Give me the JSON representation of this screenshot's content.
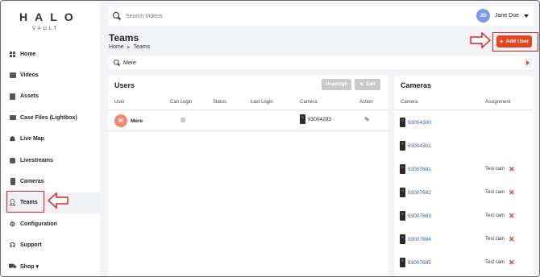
{
  "brand": {
    "name": "HALO",
    "sub": "VAULT"
  },
  "sidebar": {
    "items": [
      {
        "label": "Home",
        "icon": "grid-icon"
      },
      {
        "label": "Videos",
        "icon": "video-icon"
      },
      {
        "label": "Assets",
        "icon": "asset-icon"
      },
      {
        "label": "Case Files (Lightbox)",
        "icon": "folder-icon"
      },
      {
        "label": "Live Map",
        "icon": "map-icon"
      },
      {
        "label": "Livestreams",
        "icon": "stream-icon"
      },
      {
        "label": "Cameras",
        "icon": "camera-icon"
      },
      {
        "label": "Teams",
        "icon": "person-icon",
        "active": true
      },
      {
        "label": "Configuration",
        "icon": "gear-icon"
      },
      {
        "label": "Support",
        "icon": "headset-icon"
      },
      {
        "label": "Shop ▾",
        "icon": "cart-icon"
      }
    ]
  },
  "topbar": {
    "search_placeholder": "Search Videos",
    "user_initials": "JD",
    "user_name": "Jane Doe"
  },
  "page": {
    "title": "Teams",
    "breadcrumb": [
      "Home",
      "Teams"
    ],
    "add_button": "Add User",
    "team_name": "Mere"
  },
  "users": {
    "title": "Users",
    "unassign_label": "Unassign",
    "edit_label": "Edit",
    "columns": [
      "User",
      "Can Login",
      "Status",
      "Last Login",
      "Camera",
      "Action"
    ],
    "rows": [
      {
        "initial": "M",
        "name": "Mere",
        "camera": "93004293"
      }
    ]
  },
  "cameras": {
    "title": "Cameras",
    "columns": [
      "Camera",
      "Assignment"
    ],
    "rows": [
      {
        "id": "93004300",
        "assignment": ""
      },
      {
        "id": "93004301",
        "assignment": ""
      },
      {
        "id": "93007681",
        "assignment": "Test cam"
      },
      {
        "id": "93007682",
        "assignment": "Test cam"
      },
      {
        "id": "93007683",
        "assignment": "Test cam"
      },
      {
        "id": "93007684",
        "assignment": "Test cam"
      },
      {
        "id": "93007685",
        "assignment": "Test cam"
      }
    ]
  },
  "colors": {
    "accent": "#e0451f",
    "annotation": "#e02020",
    "link": "#2e5d9e"
  }
}
